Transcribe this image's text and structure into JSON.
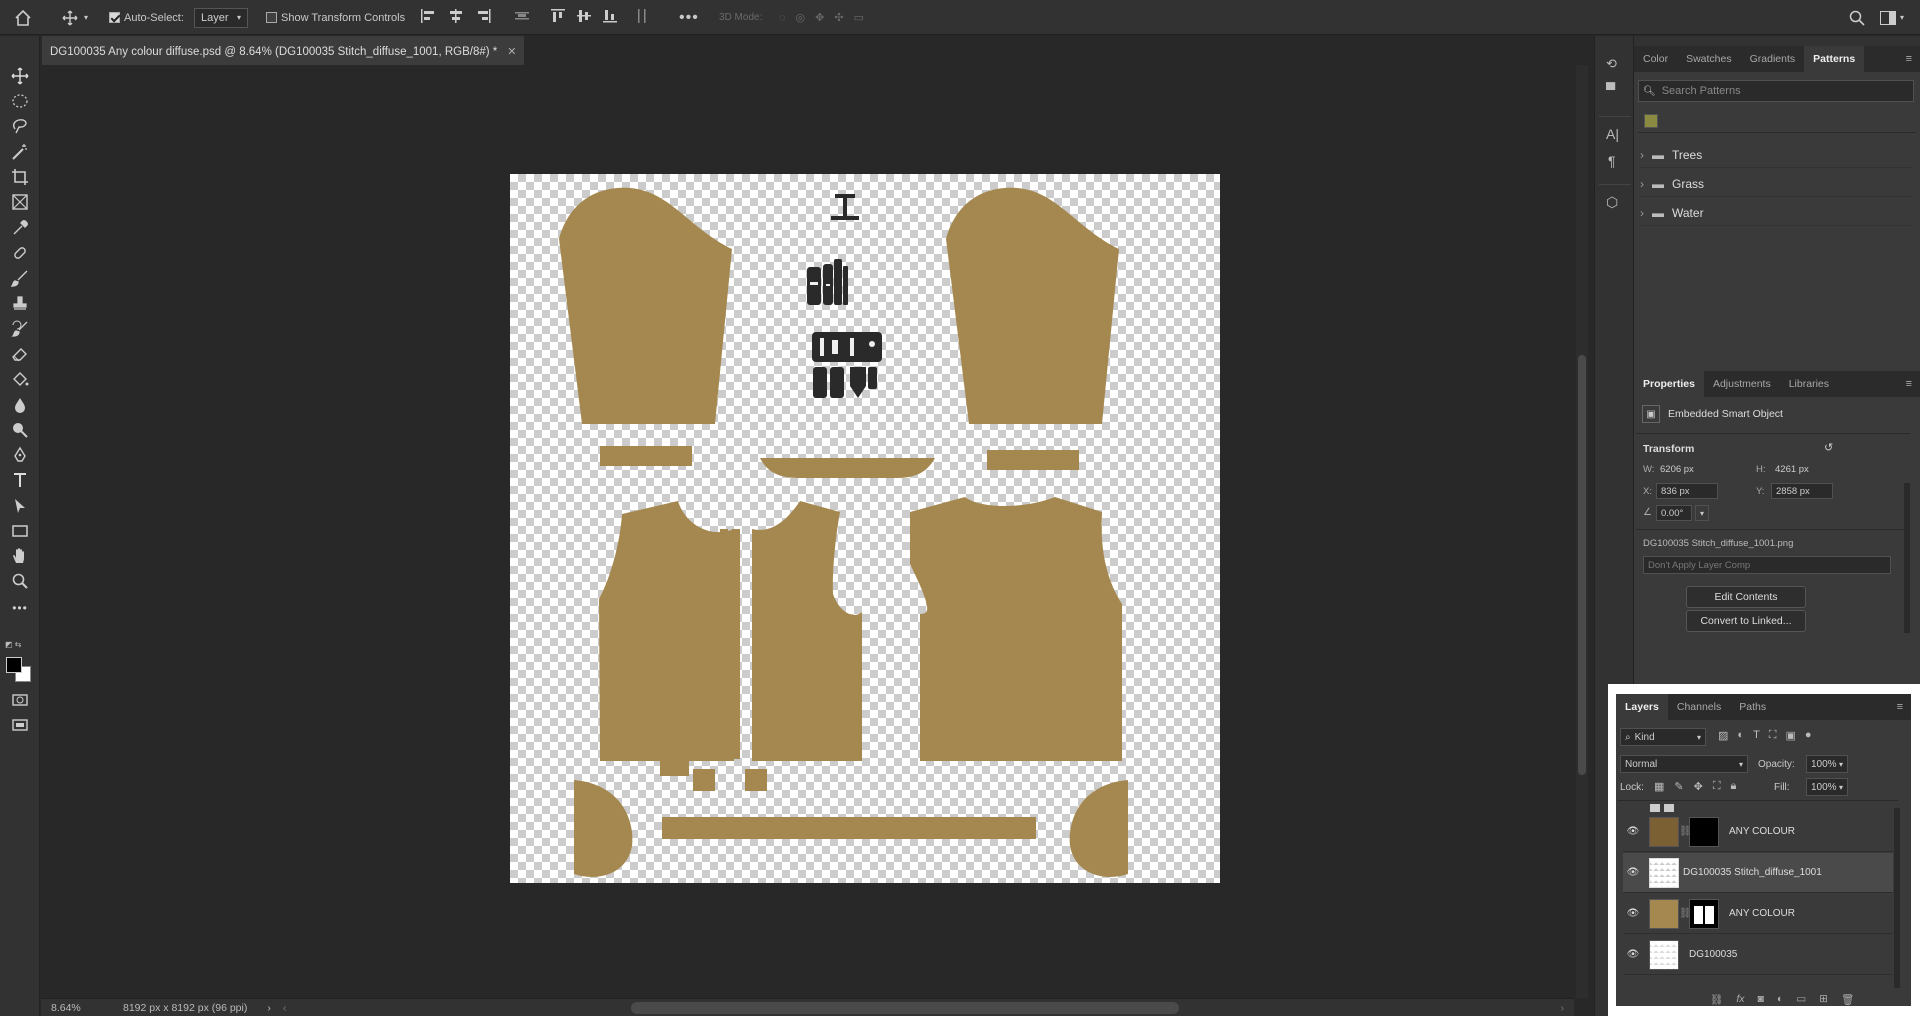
{
  "options": {
    "auto_select_label": "Auto-Select:",
    "auto_select_value": "Layer",
    "show_transform_label": "Show Transform Controls",
    "mode_3d_label": "3D Mode:"
  },
  "document": {
    "tab_title": "DG100035 Any colour diffuse.psd @ 8.64% (DG100035 Stitch_diffuse_1001, RGB/8#) *"
  },
  "status": {
    "zoom": "8.64%",
    "doc_size": "8192 px x 8192 px (96 ppi)"
  },
  "colors": {
    "fabric": "#a5884f",
    "dark_piece": "#2a2a2a",
    "panel_bg": "#3a3a3a",
    "workspace": "#282828"
  },
  "patterns_panel": {
    "tabs": [
      "Color",
      "Swatches",
      "Gradients",
      "Patterns"
    ],
    "search_placeholder": "Search Patterns",
    "folders": [
      "Trees",
      "Grass",
      "Water"
    ]
  },
  "properties_panel": {
    "tabs": [
      "Properties",
      "Adjustments",
      "Libraries"
    ],
    "kind": "Embedded Smart Object",
    "section": "Transform",
    "w_label": "W:",
    "w_value": "6206 px",
    "h_label": "H:",
    "h_value": "4261 px",
    "x_label": "X:",
    "x_value": "836 px",
    "y_label": "Y:",
    "y_value": "2858 px",
    "angle_value": "0.00°",
    "filename": "DG100035 Stitch_diffuse_1001.png",
    "layer_comp": "Don't Apply Layer Comp",
    "edit_contents": "Edit Contents",
    "convert_linked": "Convert to Linked..."
  },
  "layers_panel": {
    "tabs": [
      "Layers",
      "Channels",
      "Paths"
    ],
    "filter_kind": "Kind",
    "blend_mode": "Normal",
    "opacity_label": "Opacity:",
    "opacity_value": "100%",
    "lock_label": "Lock:",
    "fill_label": "Fill:",
    "fill_value": "100%",
    "layers": [
      {
        "name": "ANY COLOUR"
      },
      {
        "name": "DG100035 Stitch_diffuse_1001"
      },
      {
        "name": "ANY COLOUR"
      },
      {
        "name": "DG100035"
      }
    ]
  }
}
